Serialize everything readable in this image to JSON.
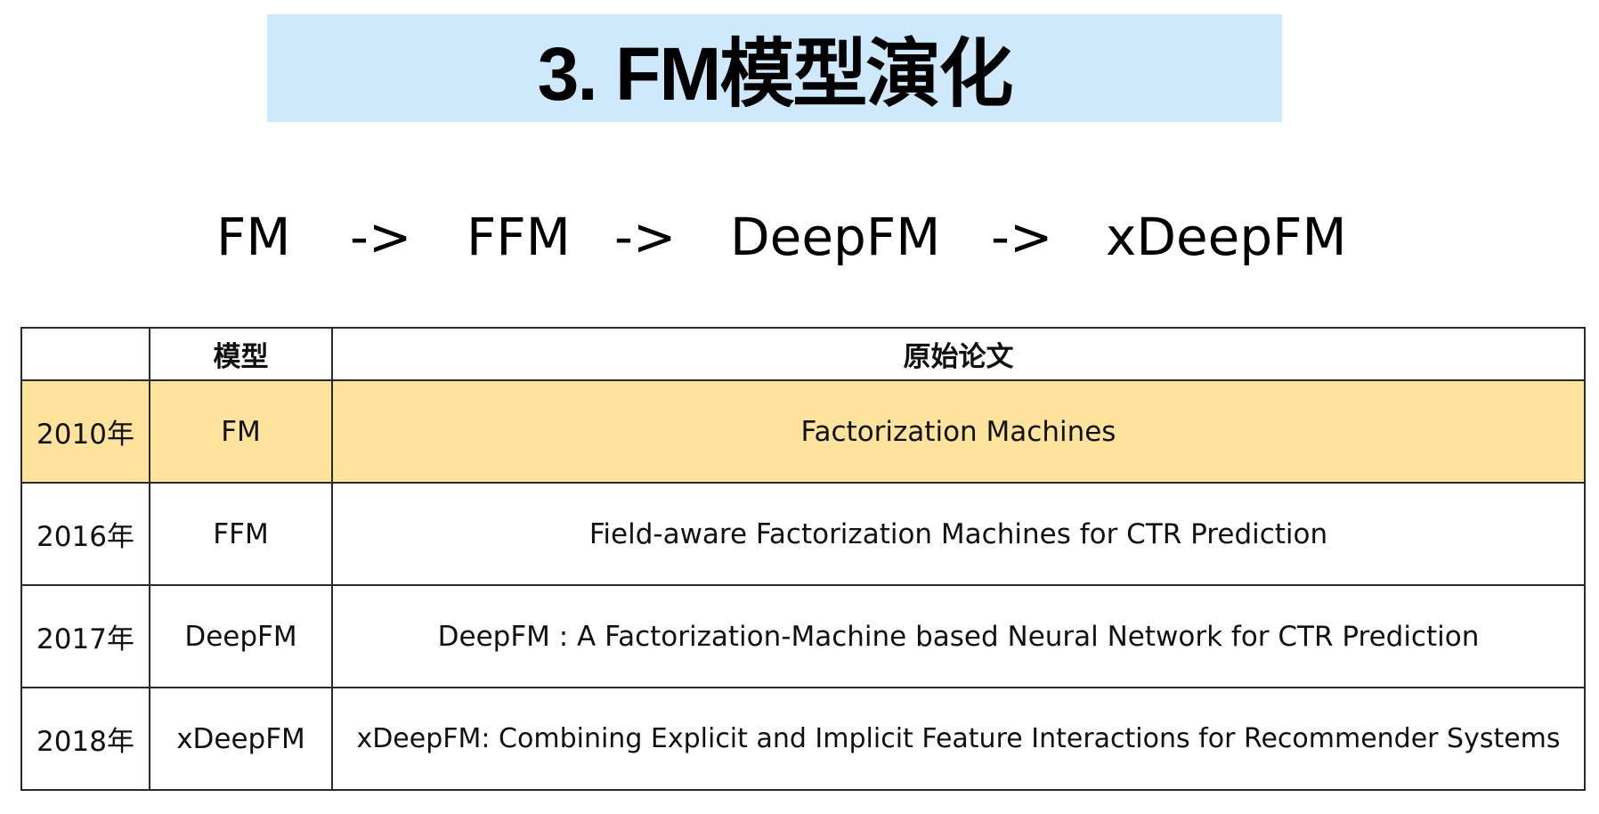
{
  "title": "3. FM模型演化",
  "flow": {
    "items": [
      "FM",
      "FFM",
      "DeepFM",
      "xDeepFM"
    ],
    "arrow": "->"
  },
  "table": {
    "headers": [
      "",
      "模型",
      "原始论文"
    ],
    "rows": [
      {
        "year": "2010年",
        "model": "FM",
        "paper": "Factorization Machines",
        "highlighted": true
      },
      {
        "year": "2016年",
        "model": "FFM",
        "paper": "Field-aware Factorization Machines for CTR Prediction"
      },
      {
        "year": "2017年",
        "model": "DeepFM",
        "paper": "DeepFM : A Factorization-Machine based Neural Network for CTR Prediction"
      },
      {
        "year": "2018年",
        "model": "xDeepFM",
        "paper": "xDeepFM: Combining Explicit and Implicit Feature Interactions for Recommender Systems"
      }
    ]
  },
  "colors": {
    "banner": "#cde9fb",
    "highlight_row": "#fde39b"
  }
}
